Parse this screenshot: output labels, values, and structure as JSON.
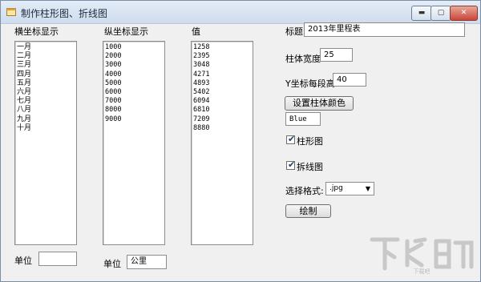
{
  "window": {
    "title": "制作柱形图、折线图"
  },
  "controls": {
    "minimize": "▬",
    "maximize": "▢",
    "close": "✕"
  },
  "headers": {
    "x_axis": "横坐标显示",
    "y_axis": "纵坐标显示",
    "value": "值"
  },
  "lists": {
    "x_axis_items": [
      "一月",
      "二月",
      "三月",
      "四月",
      "五月",
      "六月",
      "七月",
      "八月",
      "九月",
      "十月"
    ],
    "y_axis_items": [
      "1000",
      "2000",
      "3000",
      "4000",
      "5000",
      "6000",
      "7000",
      "8000",
      "9000"
    ],
    "value_items": [
      "1258",
      "2395",
      "3048",
      "4271",
      "4893",
      "5402",
      "6094",
      "6810",
      "7209",
      "8880"
    ]
  },
  "units": {
    "x_label": "单位",
    "x_value": "",
    "y_label": "单位",
    "y_value": "公里"
  },
  "settings": {
    "title_label": "标题",
    "title_value": "2013年里程表",
    "bar_width_label": "柱体宽度",
    "bar_width_value": "25",
    "y_step_label": "Y坐标每段高",
    "y_step_value": "40",
    "set_color_button": "设置柱体颜色",
    "color_value": "Blue",
    "bar_chart_label": "柱形图",
    "bar_chart_checked": true,
    "line_chart_label": "拆线图",
    "line_chart_checked": true,
    "format_label": "选择格式:",
    "format_value": ".jpg",
    "draw_button": "绘制"
  },
  "watermark": {
    "text": "下载吧"
  }
}
